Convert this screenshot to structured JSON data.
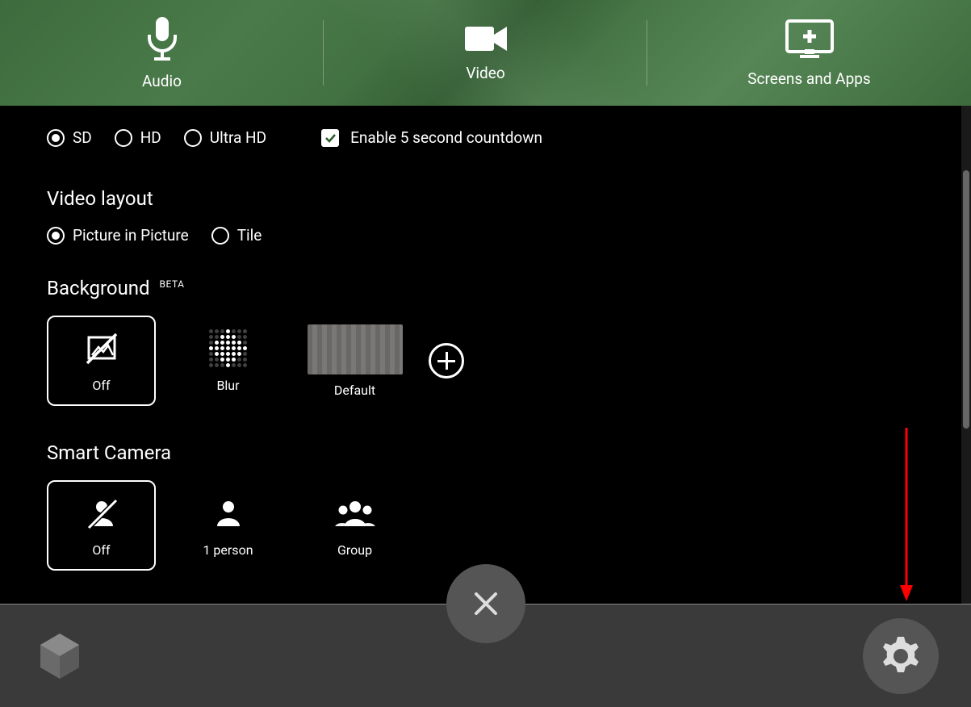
{
  "tabs": {
    "audio": "Audio",
    "video": "Video",
    "screens": "Screens and Apps"
  },
  "quality": {
    "sd": "SD",
    "hd": "HD",
    "ultra_hd": "Ultra HD",
    "countdown": "Enable 5 second countdown"
  },
  "video_layout": {
    "title": "Video layout",
    "pip": "Picture in Picture",
    "tile": "Tile"
  },
  "background": {
    "title": "Background",
    "beta": "BETA",
    "off": "Off",
    "blur": "Blur",
    "default": "Default"
  },
  "smart_camera": {
    "title": "Smart Camera",
    "off": "Off",
    "one_person": "1 person",
    "group": "Group"
  }
}
